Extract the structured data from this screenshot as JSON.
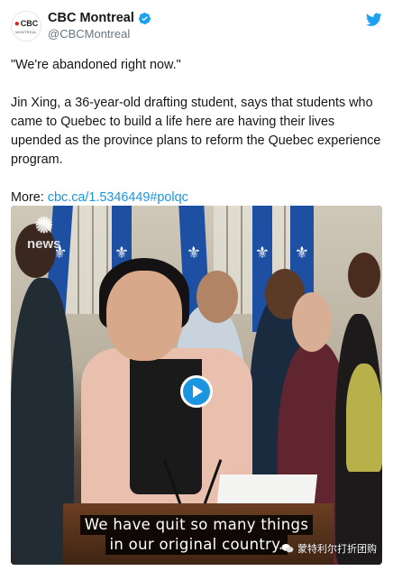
{
  "account": {
    "display_name": "CBC Montreal",
    "handle": "@CBCMontreal",
    "avatar_brand": "CBC",
    "avatar_sub": "MONTREAL"
  },
  "tweet": {
    "quote": "\"We're abandoned right now.\"",
    "body": "Jin Xing, a 36-year-old drafting student, says that students who came to Quebec to build a life here are having their lives upended as the province plans to reform the Quebec experience program.",
    "more_label": "More: ",
    "more_link": "cbc.ca/1.5346449",
    "hashtag": "#polqc"
  },
  "video": {
    "logo_text": "news",
    "caption_line1": "We have quit so many things",
    "caption_line2": "in our original country."
  },
  "watermark": {
    "text": "蒙特利尔打折团购"
  },
  "colors": {
    "link": "#1b95e0",
    "cbc_red": "#e0201b",
    "text": "#14171a",
    "secondary": "#657786"
  }
}
